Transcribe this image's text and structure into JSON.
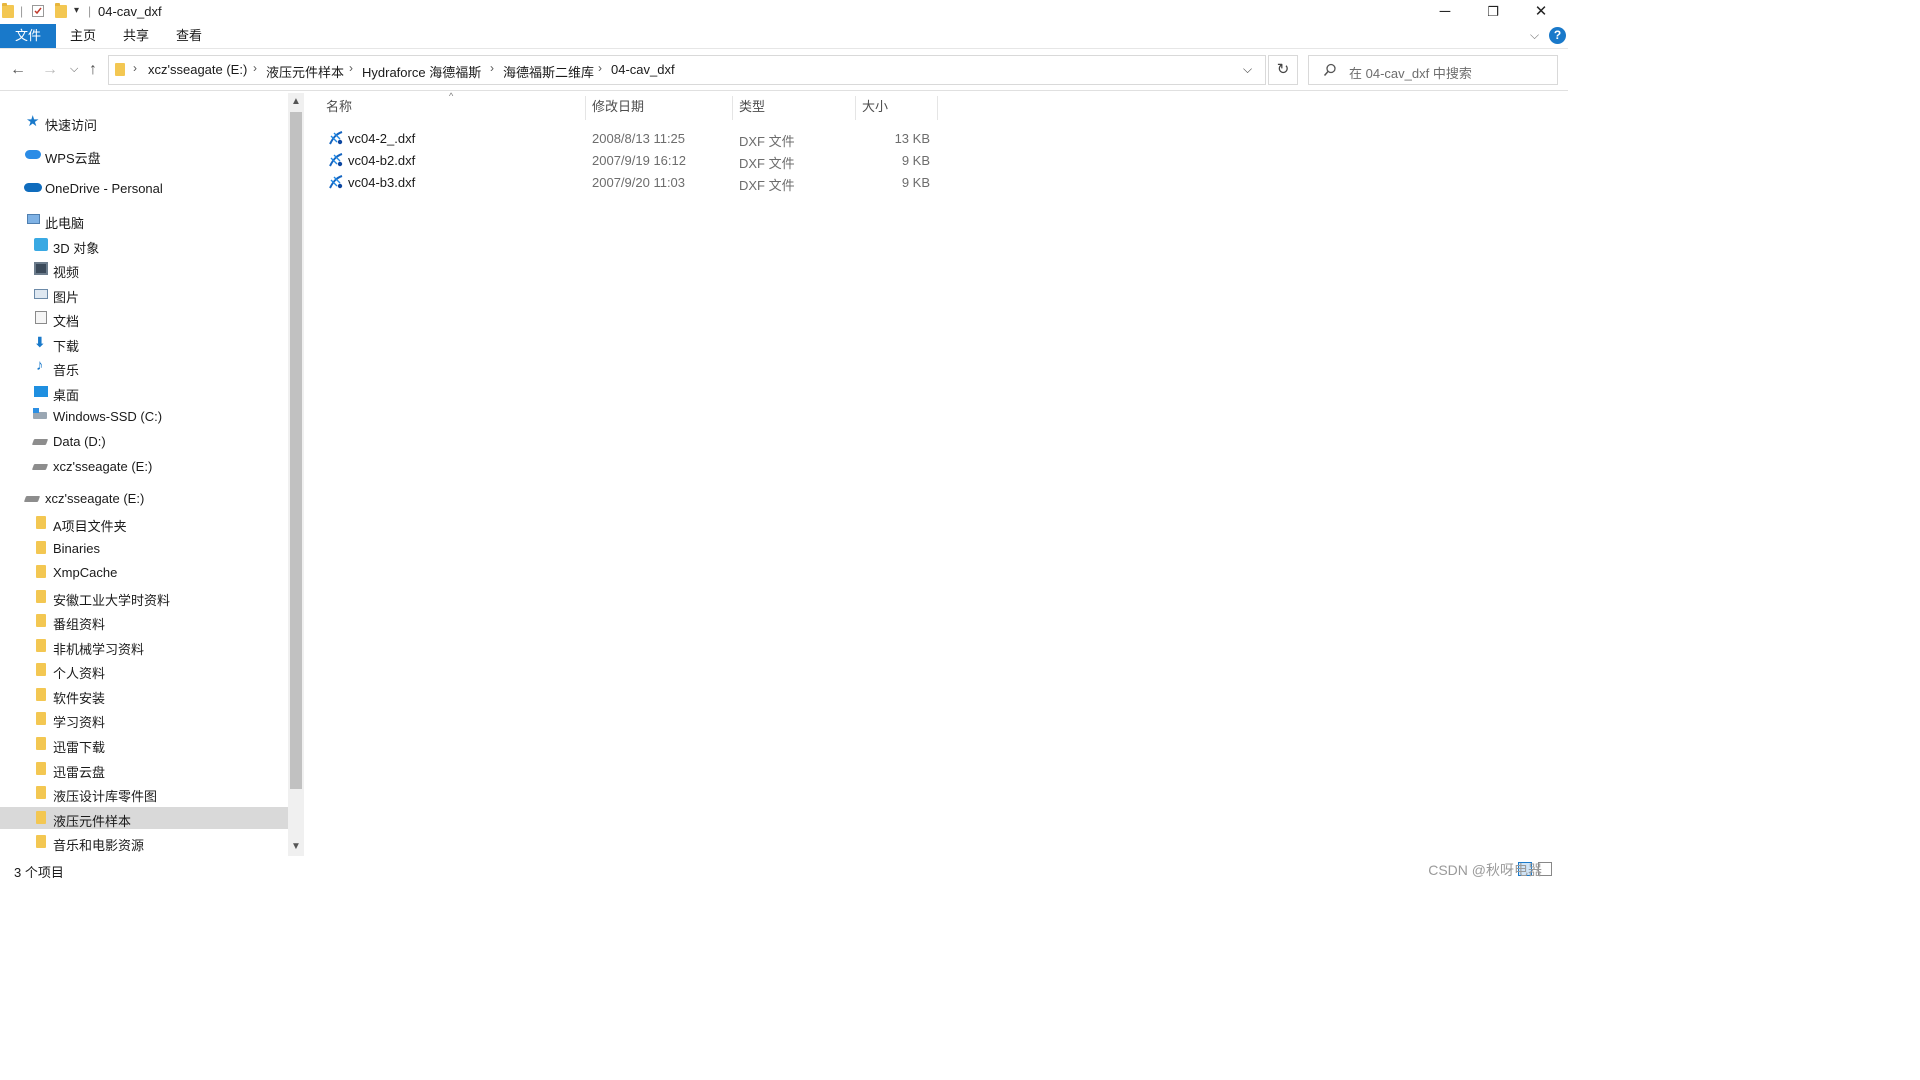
{
  "window": {
    "title": "04-cav_dxf",
    "minimize": "─",
    "restore": "❐",
    "close": "✕"
  },
  "ribbon": {
    "tabs": [
      "文件",
      "主页",
      "共享",
      "查看"
    ]
  },
  "address": {
    "crumbs": [
      "xcz'sseagate (E:)",
      "液压元件样本",
      "Hydraforce 海德福斯",
      "海德福斯二维库",
      "04-cav_dxf"
    ],
    "search_placeholder": "在 04-cav_dxf 中搜索"
  },
  "nav": {
    "quick_access": "快速访问",
    "wps": "WPS云盘",
    "onedrive": "OneDrive - Personal",
    "this_pc": "此电脑",
    "pc_items": [
      "3D 对象",
      "视频",
      "图片",
      "文档",
      "下载",
      "音乐",
      "桌面",
      "Windows-SSD (C:)",
      "Data (D:)",
      "xcz'sseagate (E:)"
    ],
    "drive_root": "xcz'sseagate (E:)",
    "folders": [
      "A项目文件夹",
      "Binaries",
      "XmpCache",
      "安徽工业大学时资料",
      "番组资料",
      "非机械学习资料",
      "个人资料",
      "软件安装",
      "学习资料",
      "迅雷下载",
      "迅雷云盘",
      "液压设计库零件图",
      "液压元件样本",
      "音乐和电影资源"
    ],
    "selected_folder": "液压元件样本"
  },
  "columns": {
    "name": "名称",
    "date": "修改日期",
    "type": "类型",
    "size": "大小"
  },
  "files": [
    {
      "name": "vc04-2_.dxf",
      "date": "2008/8/13 11:25",
      "type": "DXF 文件",
      "size": "13 KB"
    },
    {
      "name": "vc04-b2.dxf",
      "date": "2007/9/19 16:12",
      "type": "DXF 文件",
      "size": "9 KB"
    },
    {
      "name": "vc04-b3.dxf",
      "date": "2007/9/20 11:03",
      "type": "DXF 文件",
      "size": "9 KB"
    }
  ],
  "status": {
    "item_count": "3 个项目"
  },
  "watermark": "CSDN @秋呀电器",
  "colors": {
    "accent": "#1979ca",
    "selection": "#d9d9d9",
    "folder": "#f3c752"
  }
}
